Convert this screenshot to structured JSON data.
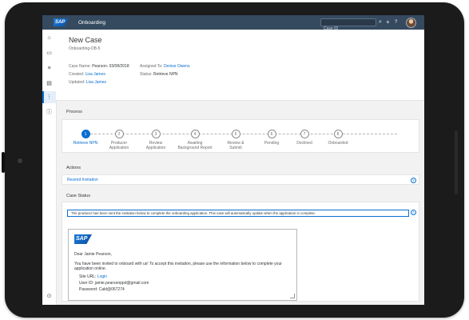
{
  "app": {
    "title": "Onboarding",
    "logo_text": "SAP"
  },
  "shell": {
    "search_placeholder": "Case ID"
  },
  "header": {
    "title": "New Case",
    "subtitle": "Onboarding-OB-5",
    "case_name_label": "Case Name:",
    "case_name_value": "Pearson: 03/08/2018",
    "created_label": "Created:",
    "created_value": "Lisa James",
    "updated_label": "Updated:",
    "updated_value": "Lisa James",
    "assigned_label": "Assigned To:",
    "assigned_value": "Denise Owens",
    "status_label": "Status:",
    "status_value": "Retrieve NPN"
  },
  "process": {
    "label": "Process",
    "steps": [
      {
        "num": "1",
        "label": "Retrieve NPN"
      },
      {
        "num": "2",
        "label": "Producer\nApplication"
      },
      {
        "num": "3",
        "label": "Review\nApplication"
      },
      {
        "num": "4",
        "label": "Awaiting\nBackground Report"
      },
      {
        "num": "5",
        "label": "Review &\nSubmit"
      },
      {
        "num": "6",
        "label": "Pending"
      },
      {
        "num": "7",
        "label": "Declined"
      },
      {
        "num": "8",
        "label": "Onboarded"
      }
    ]
  },
  "actions": {
    "label": "Actions",
    "resend": "Resend Invitation"
  },
  "case_status": {
    "label": "Case Status",
    "message": "The producer has been sent the invitation below to complete the onboarding application. This case will automatically update when the application is complete.",
    "email": {
      "logo": "SAP",
      "greeting": "Dear Jamie Pearson,",
      "body": "You have been invited to onboard with us! To accept this invitation, please use the information below to complete your application online.",
      "site_label": "Site URL:",
      "site_value": "Login",
      "user_label": "User ID:",
      "user_value": "jamie.pearsonppd@gmail.com",
      "password_label": "Password:",
      "password_value": "Cald@067274"
    }
  },
  "colors": {
    "shell": "#354a5f",
    "accent": "#0a6ed1",
    "background": "#f2f2f2"
  }
}
